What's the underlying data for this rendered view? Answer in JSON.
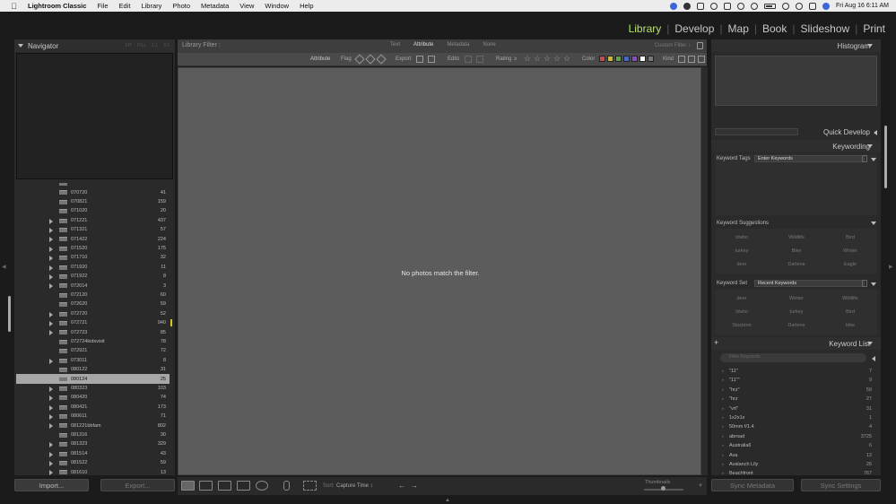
{
  "menubar": {
    "app": "Lightroom Classic",
    "items": [
      "File",
      "Edit",
      "Library",
      "Photo",
      "Metadata",
      "View",
      "Window",
      "Help"
    ],
    "clock": "Fri Aug 16  6:11 AM"
  },
  "modules": [
    {
      "label": "Library",
      "active": true
    },
    {
      "label": "Develop",
      "active": false
    },
    {
      "label": "Map",
      "active": false
    },
    {
      "label": "Book",
      "active": false
    },
    {
      "label": "Slideshow",
      "active": false
    },
    {
      "label": "Print",
      "active": false
    }
  ],
  "navigator": {
    "title": "Navigator",
    "zoom_options": [
      "FIT",
      "FILL",
      "1:1",
      "3:1"
    ]
  },
  "folders": [
    {
      "name": "",
      "count": "",
      "arrow": false
    },
    {
      "name": "070720",
      "count": "41",
      "arrow": false
    },
    {
      "name": "070821",
      "count": "159",
      "arrow": false
    },
    {
      "name": "071020",
      "count": "20",
      "arrow": false
    },
    {
      "name": "071221",
      "count": "437",
      "arrow": true
    },
    {
      "name": "071321",
      "count": "57",
      "arrow": true
    },
    {
      "name": "071422",
      "count": "224",
      "arrow": true
    },
    {
      "name": "071520",
      "count": "175",
      "arrow": true
    },
    {
      "name": "071710",
      "count": "32",
      "arrow": true
    },
    {
      "name": "071920",
      "count": "11",
      "arrow": true
    },
    {
      "name": "071922",
      "count": "8",
      "arrow": true
    },
    {
      "name": "072014",
      "count": "3",
      "arrow": true
    },
    {
      "name": "072120",
      "count": "60",
      "arrow": false
    },
    {
      "name": "072620",
      "count": "59",
      "arrow": false
    },
    {
      "name": "072720",
      "count": "52",
      "arrow": true
    },
    {
      "name": "072721",
      "count": "940",
      "arrow": true,
      "mark": true
    },
    {
      "name": "072723",
      "count": "85",
      "arrow": true
    },
    {
      "name": "072724kidsvisit",
      "count": "78",
      "arrow": false
    },
    {
      "name": "072921",
      "count": "72",
      "arrow": false
    },
    {
      "name": "073011",
      "count": "8",
      "arrow": true
    },
    {
      "name": "080122",
      "count": "31",
      "arrow": false
    },
    {
      "name": "080124",
      "count": "25",
      "arrow": true,
      "selected": true
    },
    {
      "name": "080323",
      "count": "103",
      "arrow": true
    },
    {
      "name": "080420",
      "count": "74",
      "arrow": true
    },
    {
      "name": "080421",
      "count": "173",
      "arrow": true
    },
    {
      "name": "080611",
      "count": "71",
      "arrow": true
    },
    {
      "name": "081221bbfam",
      "count": "802",
      "arrow": true
    },
    {
      "name": "081316",
      "count": "30",
      "arrow": false
    },
    {
      "name": "081323",
      "count": "329",
      "arrow": true
    },
    {
      "name": "081514",
      "count": "43",
      "arrow": true
    },
    {
      "name": "081522",
      "count": "59",
      "arrow": true
    },
    {
      "name": "081610",
      "count": "13",
      "arrow": true
    }
  ],
  "left_buttons": {
    "import": "Import...",
    "export": "Export..."
  },
  "filter": {
    "title": "Library Filter :",
    "tabs": [
      "Text",
      "Attribute",
      "Metadata",
      "None"
    ],
    "active_tab": "Attribute",
    "custom": "Custom Filter ↕"
  },
  "attribute_bar": {
    "attribute": "Attribute",
    "flag": "Flag",
    "export": "Export",
    "edits": "Edits",
    "rating": "Rating",
    "rating_op": "≥",
    "color": "Color",
    "kind": "Kind",
    "color_chips": [
      "#c84a4a",
      "#c8b84a",
      "#5aa84a",
      "#4a6ac8",
      "#8a4ac8",
      "#ffffff",
      "#777777"
    ]
  },
  "grid": {
    "empty_message": "No photos match the filter."
  },
  "toolbar": {
    "sort_label": "Sort:",
    "sort_value": "Capture Time ↕",
    "thumbnails_label": "Thumbnails"
  },
  "right_panel": {
    "histogram": "Histogram",
    "quick_develop": "Quick Develop",
    "keywording": "Keywording",
    "keyword_tags_label": "Keyword Tags",
    "keyword_tags_value": "Enter Keywords",
    "keyword_suggestions": "Keyword Suggestions",
    "suggestions": [
      "Idaho",
      "Wildlife",
      "Bird",
      "turkey",
      "Bike",
      "Winter",
      "deer",
      "Darlene",
      "Eagle"
    ],
    "keyword_set_label": "Keyword Set",
    "keyword_set_value": "Recent Keywords",
    "recent_keywords": [
      "deer",
      "Winter",
      "Wildlife",
      "Idaho",
      "turkey",
      "Bird",
      "Stockton",
      "Darlene",
      "bike"
    ],
    "keyword_list": "Keyword List",
    "keyword_search_placeholder": "Filter Keywords",
    "keywords": [
      {
        "name": "\"11\"",
        "count": "7"
      },
      {
        "name": "\"11\"\"",
        "count": "9"
      },
      {
        "name": "\"hrz\"",
        "count": "59"
      },
      {
        "name": "\"hrz",
        "count": "27"
      },
      {
        "name": "\"vrt\"",
        "count": "31"
      },
      {
        "name": "1x2x1x",
        "count": "1"
      },
      {
        "name": "50mm f/1.4",
        "count": "4"
      },
      {
        "name": "abroad",
        "count": "3725"
      },
      {
        "name": "Australia6",
        "count": "6"
      },
      {
        "name": "Ava",
        "count": "13"
      },
      {
        "name": "Avalanch Lily",
        "count": "26"
      },
      {
        "name": "Beachfront",
        "count": "767"
      }
    ]
  },
  "right_buttons": {
    "sync_metadata": "Sync Metadata",
    "sync_settings": "Sync Settings"
  }
}
